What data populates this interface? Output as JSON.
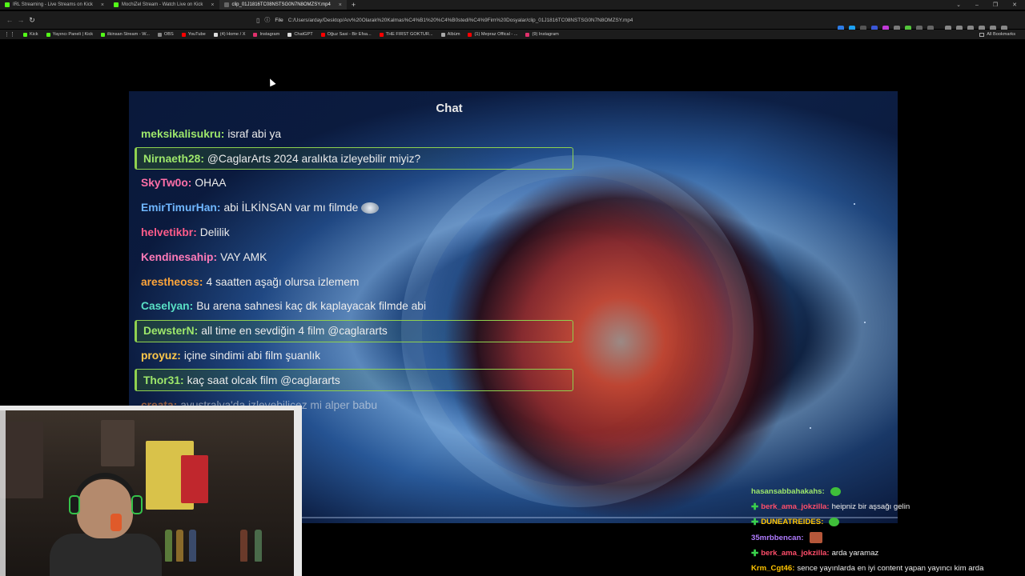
{
  "browser": {
    "tabs": [
      {
        "title": "IRL Streaming - Live Streams on Kick",
        "active": false
      },
      {
        "title": "MochiZel Stream - Watch Live on Kick",
        "active": false
      },
      {
        "title": "clip_01J1816TC08NSTSG0N7N8OMZSY.mp4",
        "active": true
      }
    ],
    "new_tab": "+",
    "address": {
      "scheme_label": "File",
      "url": "C:/Users/arday/Desktop/Arv%20Olarak%20Kalmas%C4%B1%20%C4%B0stedi%C4%9Fim%20Dosyalar/clip_01J1816TC08NSTSG0N7N8OMZSY.mp4"
    },
    "bookmarks": [
      {
        "label": "Kick",
        "color": "#53fc18"
      },
      {
        "label": "Yayıncı Paneli | Kick",
        "color": "#53fc18"
      },
      {
        "label": "ilkinsan Stream - W...",
        "color": "#53fc18"
      },
      {
        "label": "OBS",
        "color": "#888888"
      },
      {
        "label": "YouTube",
        "color": "#ff0000"
      },
      {
        "label": "(4) Home / X",
        "color": "#dddddd"
      },
      {
        "label": "Instagram",
        "color": "#e1306c"
      },
      {
        "label": "ChatGPT",
        "color": "#dddddd"
      },
      {
        "label": "Oğuz Sasi - Bir Efsa...",
        "color": "#ff0000"
      },
      {
        "label": "THE FIRST GOKTUR...",
        "color": "#ff0000"
      },
      {
        "label": "Albüm",
        "color": "#aaaaaa"
      },
      {
        "label": "(1) Mepraz Offical - ...",
        "color": "#ff0000"
      },
      {
        "label": "(9) Instagram",
        "color": "#e1306c"
      }
    ],
    "all_bookmarks": "All Bookmarks"
  },
  "video": {
    "chat_title": "Chat",
    "messages": [
      {
        "user": "meksikalisukru",
        "text": "israf abi ya",
        "color": "#9ee86b",
        "highlight": false
      },
      {
        "user": "Nirnaeth28",
        "text": "@CaglarArts 2024 aralıkta izleyebilir miyiz?",
        "color": "#9ee86b",
        "highlight": true
      },
      {
        "user": "SkyTw0o",
        "text": "OHAA",
        "color": "#ff6fa8",
        "highlight": false
      },
      {
        "user": "EmirTimurHan",
        "text": "abi İLKİNSAN var mı filmde",
        "color": "#6fb6ff",
        "highlight": false,
        "emote": "emote"
      },
      {
        "user": "helvetikbr",
        "text": "Delilik",
        "color": "#ff5c8a",
        "highlight": false
      },
      {
        "user": "Kendinesahip",
        "text": "VAY AMK",
        "color": "#ff7ab8",
        "highlight": false
      },
      {
        "user": "arestheoss",
        "text": "4 saatten aşağı olursa izlemem",
        "color": "#ffa53a",
        "highlight": false
      },
      {
        "user": "Caselyan",
        "text": "Bu arena sahnesi kaç dk kaplayacak filmde abi",
        "color": "#59e0c5",
        "highlight": false
      },
      {
        "user": "DewsterN",
        "text": "all time en sevdiğin 4 film @caglararts",
        "color": "#9ee86b",
        "highlight": true
      },
      {
        "user": "proyuz",
        "text": "içine sindimi abi film şuanlık",
        "color": "#ffc84a",
        "highlight": false
      },
      {
        "user": "Thor31",
        "text": "kaç saat olcak film @caglararts",
        "color": "#9ee86b",
        "highlight": true
      },
      {
        "user": "creata",
        "text": "avustralya'da izleyebilicez mi alper babu",
        "color": "#ff8c3a",
        "highlight": false,
        "cut": true
      }
    ]
  },
  "side_chat": [
    {
      "plus": false,
      "user": "hasansabbahakahs",
      "text": "",
      "color": "#9ee86b",
      "emote": "green-emote"
    },
    {
      "plus": true,
      "user": "berk_ama_jokzilla",
      "text": "heipniz bir aşsağı gelin",
      "color": "#ff4d6a"
    },
    {
      "plus": true,
      "user": "DUNEATREIDES",
      "text": "",
      "color": "#ffc400",
      "emote": "green-emote"
    },
    {
      "plus": false,
      "user": "35mrbbencan",
      "text": "",
      "color": "#b07bff",
      "emote": "pic-emote"
    },
    {
      "plus": true,
      "user": "berk_ama_jokzilla",
      "text": "arda yaramaz",
      "color": "#ff4d6a"
    },
    {
      "plus": false,
      "user": "Krm_Cgt46",
      "text": "sence yayınlarda en iyi content yapan yayıncı kim arda",
      "color": "#ffc400"
    }
  ],
  "icons": {
    "back": "arrow-left-icon",
    "forward": "arrow-right-icon",
    "reload": "reload-icon",
    "apps": "apps-grid-icon"
  }
}
